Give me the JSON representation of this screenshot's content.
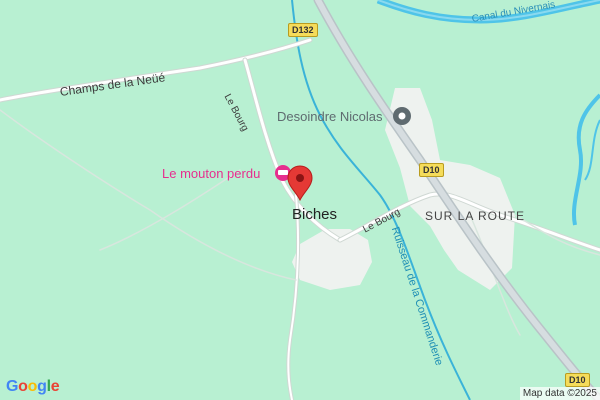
{
  "map": {
    "colors": {
      "land": "#b8f0d2",
      "water": "#4fc4e8",
      "road": "#ffffff",
      "road_casing": "#cfd8d3",
      "highway": "#d6dde0",
      "built_up": "#eef2ef",
      "marker": "#e53935",
      "poi_pink": "#e62e8e",
      "poi_gray": "#5f6b70"
    },
    "water_labels": {
      "canal": "Canal du Nivernais",
      "stream": "Ruisseau de la Commanderie"
    },
    "road_labels": {
      "champs": "Champs de la Neüé",
      "le_bourg_north": "Le Bourg",
      "le_bourg_east": "Le Bourg"
    },
    "shields": {
      "d132": "D132",
      "d10_north": "D10",
      "d10_south": "D10"
    },
    "places": {
      "village": "Biches",
      "hamlet": "SUR LA ROUTE"
    },
    "pois": {
      "restaurant": "Le mouton perdu",
      "business": "Desoindre Nicolas"
    },
    "marker": "location-pin-icon",
    "attribution": "Map data ©2025",
    "logo": "Google"
  }
}
